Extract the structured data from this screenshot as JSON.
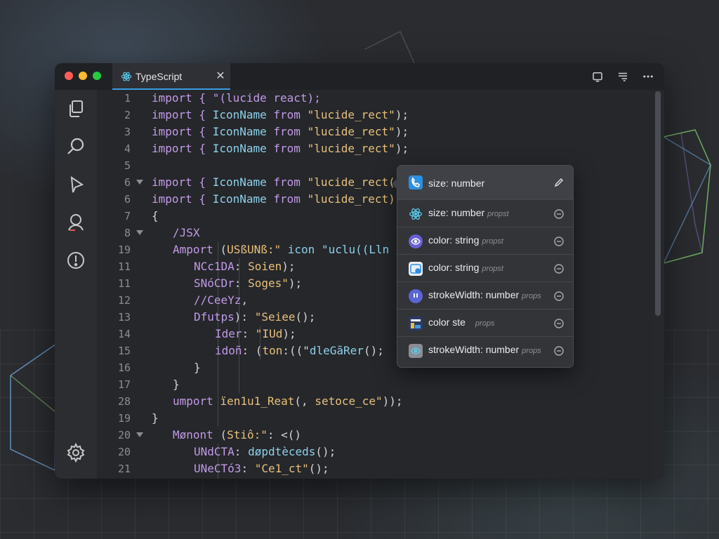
{
  "window": {
    "tab": {
      "icon": "react-atom-icon",
      "label": "TypeScript",
      "close_icon": "close-icon"
    },
    "title_actions": [
      "split-view-icon",
      "layout-icon",
      "more-icon"
    ]
  },
  "activity_bar": [
    "files-icon",
    "search-icon",
    "run-debug-icon",
    "accounts-icon",
    "problems-icon",
    "settings-icon"
  ],
  "editor": {
    "lines": [
      {
        "num": "1",
        "indent": 0,
        "tokens": [
          {
            "t": "import { \"(lucide react);",
            "c": "kw"
          }
        ]
      },
      {
        "num": "2",
        "indent": 0,
        "tokens": [
          {
            "t": "import { ",
            "c": "kw"
          },
          {
            "t": "IconName ",
            "c": "fn"
          },
          {
            "t": "from ",
            "c": "kw"
          },
          {
            "t": "\"lucide_rect\"",
            "c": "str"
          },
          {
            "t": ");",
            "c": ""
          }
        ]
      },
      {
        "num": "3",
        "indent": 0,
        "tokens": [
          {
            "t": "import { ",
            "c": "kw"
          },
          {
            "t": "IconName ",
            "c": "fn"
          },
          {
            "t": "from ",
            "c": "kw"
          },
          {
            "t": "\"lucide_rect\"",
            "c": "str"
          },
          {
            "t": ");",
            "c": ""
          }
        ]
      },
      {
        "num": "4",
        "indent": 0,
        "tokens": [
          {
            "t": "import { ",
            "c": "kw"
          },
          {
            "t": "IconName ",
            "c": "fn"
          },
          {
            "t": "from ",
            "c": "kw"
          },
          {
            "t": "\"lucide_rect\"",
            "c": "str"
          },
          {
            "t": ");",
            "c": ""
          }
        ]
      },
      {
        "num": "5",
        "indent": 0,
        "tokens": []
      },
      {
        "num": "6",
        "indent": 0,
        "fold": true,
        "tokens": [
          {
            "t": "import { ",
            "c": "kw"
          },
          {
            "t": "IconName ",
            "c": "fn"
          },
          {
            "t": "from ",
            "c": "kw"
          },
          {
            "t": "\"lucide_rect(",
            "c": "str"
          }
        ]
      },
      {
        "num": "6",
        "indent": 0,
        "tokens": [
          {
            "t": "import { ",
            "c": "kw"
          },
          {
            "t": "IconName ",
            "c": "fn"
          },
          {
            "t": "from ",
            "c": "kw"
          },
          {
            "t": "\"lucide_rect)",
            "c": "str"
          }
        ]
      },
      {
        "num": "7",
        "indent": 0,
        "tokens": [
          {
            "t": "{",
            "c": ""
          }
        ]
      },
      {
        "num": "8",
        "indent": 1,
        "fold": true,
        "tokens": [
          {
            "t": "/JSX",
            "c": "kw"
          }
        ]
      },
      {
        "num": "19",
        "indent": 1,
        "tokens": [
          {
            "t": "Amport ",
            "c": "kw"
          },
          {
            "t": "(",
            "c": ""
          },
          {
            "t": "USßUNß:\"",
            "c": "str"
          },
          {
            "t": " icon \"uclu((Lln",
            "c": "fn"
          }
        ]
      },
      {
        "num": "11",
        "indent": 2,
        "tokens": [
          {
            "t": "NCc1DA",
            "c": "kw"
          },
          {
            "t": ": ",
            "c": ""
          },
          {
            "t": "Soien",
            "c": "str"
          },
          {
            "t": ");",
            "c": ""
          }
        ]
      },
      {
        "num": "11",
        "indent": 2,
        "tokens": [
          {
            "t": "SNóCDr",
            "c": "kw"
          },
          {
            "t": ": ",
            "c": ""
          },
          {
            "t": "Soges\"",
            "c": "str"
          },
          {
            "t": ");",
            "c": ""
          }
        ]
      },
      {
        "num": "12",
        "indent": 2,
        "tokens": [
          {
            "t": "//CeeYz",
            "c": "kw"
          },
          {
            "t": ",",
            "c": ""
          }
        ]
      },
      {
        "num": "13",
        "indent": 2,
        "tokens": [
          {
            "t": "Dfutps",
            "c": "kw"
          },
          {
            "t": "): ",
            "c": ""
          },
          {
            "t": "\"Seiee",
            "c": "str"
          },
          {
            "t": "();",
            "c": ""
          }
        ]
      },
      {
        "num": "14",
        "indent": 3,
        "tokens": [
          {
            "t": "Ider",
            "c": "kw"
          },
          {
            "t": ": ",
            "c": ""
          },
          {
            "t": "\"IUd",
            "c": "str"
          },
          {
            "t": ");",
            "c": ""
          }
        ]
      },
      {
        "num": "15",
        "indent": 3,
        "tokens": [
          {
            "t": "idoñ",
            "c": "kw"
          },
          {
            "t": ": (",
            "c": ""
          },
          {
            "t": "ton",
            "c": "str"
          },
          {
            "t": ":((\"",
            "c": ""
          },
          {
            "t": "dleGãRer",
            "c": "fn"
          },
          {
            "t": "();",
            "c": ""
          }
        ]
      },
      {
        "num": "16",
        "indent": 2,
        "tokens": [
          {
            "t": "}",
            "c": ""
          }
        ]
      },
      {
        "num": "17",
        "indent": 1,
        "tokens": [
          {
            "t": "}",
            "c": ""
          }
        ]
      },
      {
        "num": "28",
        "indent": 1,
        "tokens": [
          {
            "t": "umport ",
            "c": "kw"
          },
          {
            "t": "ïen1u1_Reat",
            "c": "str"
          },
          {
            "t": "(, ",
            "c": ""
          },
          {
            "t": "setoce_ce\"",
            "c": "str"
          },
          {
            "t": "));",
            "c": ""
          }
        ]
      },
      {
        "num": "19",
        "indent": 0,
        "tokens": [
          {
            "t": "}",
            "c": ""
          }
        ]
      },
      {
        "num": "20",
        "indent": 1,
        "fold": true,
        "tokens": [
          {
            "t": "Mønont ",
            "c": "kw"
          },
          {
            "t": "(",
            "c": ""
          },
          {
            "t": "Stiô:\"",
            "c": "str"
          },
          {
            "t": ": <()",
            "c": ""
          }
        ]
      },
      {
        "num": "20",
        "indent": 2,
        "tokens": [
          {
            "t": "UNdCTA",
            "c": "kw"
          },
          {
            "t": ": ",
            "c": ""
          },
          {
            "t": "døpdtèceds",
            "c": "fn"
          },
          {
            "t": "();",
            "c": ""
          }
        ]
      },
      {
        "num": "21",
        "indent": 2,
        "tokens": [
          {
            "t": "UNeCTó3",
            "c": "kw"
          },
          {
            "t": ": ",
            "c": ""
          },
          {
            "t": "\"Ce1_ct\"",
            "c": "str"
          },
          {
            "t": "();",
            "c": ""
          }
        ]
      }
    ]
  },
  "autocomplete": {
    "header": {
      "icon": "phone-icon",
      "label": "size: number",
      "action_icon": "pencil-icon"
    },
    "items": [
      {
        "icon": "react-atom-icon",
        "label": "size: number",
        "hint": "propst",
        "end_icon": "minus-circle-icon"
      },
      {
        "icon": "eye-icon",
        "label": "color: string",
        "hint": "propst",
        "end_icon": "minus-circle-icon"
      },
      {
        "icon": "image-icon",
        "label": "color: string",
        "hint": "propst",
        "end_icon": "minus-circle-icon"
      },
      {
        "icon": "info-icon",
        "label": "strokeWidth: number",
        "hint": "props",
        "end_icon": "minus-circle-icon"
      },
      {
        "icon": "chart-icon",
        "label": "color ste",
        "hint": "props",
        "end_icon": "minus-circle-icon"
      },
      {
        "icon": "eye-icon",
        "label": "strokeWidth: number",
        "hint": "props",
        "end_icon": "minus-circle-icon"
      }
    ]
  }
}
